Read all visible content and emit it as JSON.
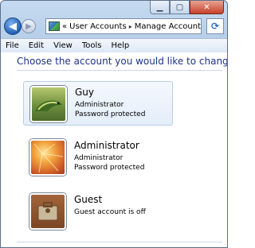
{
  "window": {
    "buttons": {
      "minimize_icon": "minimize-icon",
      "maximize_icon": "maximize-icon",
      "close_icon": "close-icon"
    }
  },
  "address_bar": {
    "overflow_glyph": "«",
    "crumbs": [
      "User Accounts",
      "Manage Accounts"
    ],
    "separator": "▸",
    "dropdown_glyph": "▼",
    "refresh_glyph": "⟳"
  },
  "menu": [
    "File",
    "Edit",
    "View",
    "Tools",
    "Help"
  ],
  "main": {
    "heading": "Choose the account you would like to change",
    "accounts": [
      {
        "name": "Guy",
        "lines": [
          "Administrator",
          "Password protected"
        ],
        "picture": "chameleon-picture",
        "selected": true
      },
      {
        "name": "Administrator",
        "lines": [
          "Administrator",
          "Password protected"
        ],
        "picture": "flower-picture",
        "selected": false
      },
      {
        "name": "Guest",
        "lines": [
          "Guest account is off"
        ],
        "picture": "briefcase-picture",
        "selected": false
      }
    ]
  },
  "colors": {
    "heading": "#1e3287",
    "frame": "#b7cfe9",
    "close_button": "#c6412a",
    "selected_tile": "#e4eefa"
  }
}
